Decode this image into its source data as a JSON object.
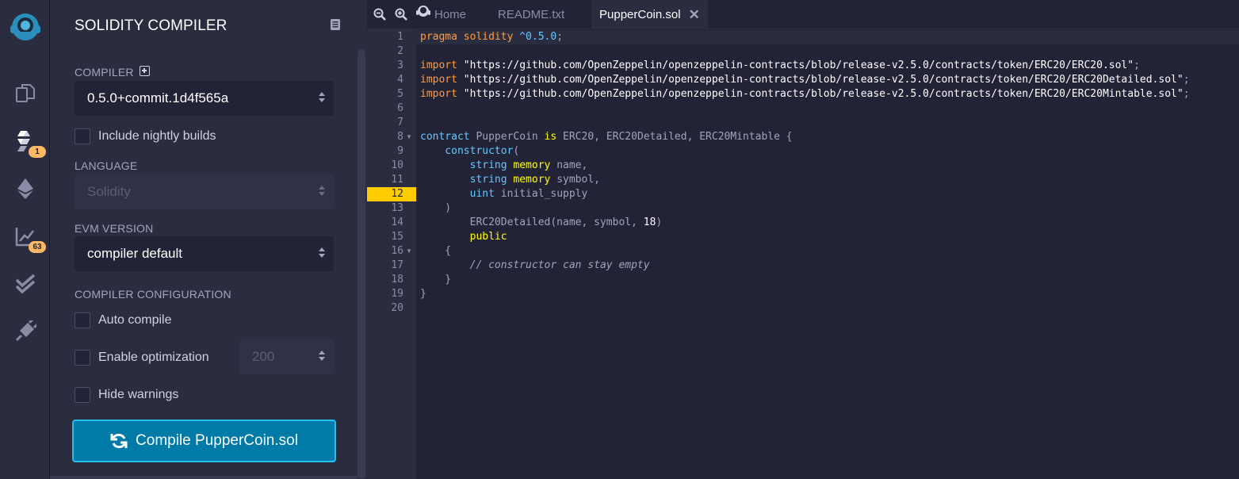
{
  "rail": {
    "badges": {
      "compiler": "1",
      "analysis": "63"
    }
  },
  "panel": {
    "title": "SOLIDITY COMPILER",
    "compiler_label": "COMPILER",
    "compiler_version": "0.5.0+commit.1d4f565a",
    "nightly_label": "Include nightly builds",
    "language_label": "LANGUAGE",
    "language_value": "Solidity",
    "evm_label": "EVM VERSION",
    "evm_value": "compiler default",
    "config_label": "COMPILER CONFIGURATION",
    "auto_compile_label": "Auto compile",
    "optimization_label": "Enable optimization",
    "optimization_runs": "200",
    "hide_warnings_label": "Hide warnings",
    "compile_button_label": "Compile PupperCoin.sol"
  },
  "tabs": [
    {
      "label": "Home"
    },
    {
      "label": "README.txt"
    },
    {
      "label": "PupperCoin.sol",
      "close": "✕"
    }
  ],
  "editor": {
    "highlighted_line": 12,
    "lines": [
      {
        "n": "1",
        "tokens": [
          [
            "pragma solidity ",
            "tk-pragma"
          ],
          [
            "^0.5.0",
            "tk-version"
          ],
          [
            ";",
            "tk-id"
          ]
        ]
      },
      {
        "n": "2",
        "tokens": []
      },
      {
        "n": "3",
        "tokens": [
          [
            "import ",
            "tk-import"
          ],
          [
            "\"https://github.com/OpenZeppelin/openzeppelin-contracts/blob/release-v2.5.0/contracts/token/ERC20/ERC20.sol\"",
            "tk-str"
          ],
          [
            ";",
            "tk-id"
          ]
        ]
      },
      {
        "n": "4",
        "tokens": [
          [
            "import ",
            "tk-import"
          ],
          [
            "\"https://github.com/OpenZeppelin/openzeppelin-contracts/blob/release-v2.5.0/contracts/token/ERC20/ERC20Detailed.sol\"",
            "tk-str"
          ],
          [
            ";",
            "tk-id"
          ]
        ]
      },
      {
        "n": "5",
        "tokens": [
          [
            "import ",
            "tk-import"
          ],
          [
            "\"https://github.com/OpenZeppelin/openzeppelin-contracts/blob/release-v2.5.0/contracts/token/ERC20/ERC20Mintable.sol\"",
            "tk-str"
          ],
          [
            ";",
            "tk-id"
          ]
        ]
      },
      {
        "n": "6",
        "tokens": []
      },
      {
        "n": "7",
        "tokens": []
      },
      {
        "n": "8",
        "fold": true,
        "tokens": [
          [
            "contract ",
            "tk-kw"
          ],
          [
            "PupperCoin ",
            "tk-id"
          ],
          [
            "is ",
            "tk-kw2"
          ],
          [
            "ERC20, ERC20Detailed, ERC20Mintable {",
            "tk-id"
          ]
        ]
      },
      {
        "n": "9",
        "tokens": [
          [
            "    constructor",
            "tk-kw"
          ],
          [
            "(",
            "tk-id"
          ]
        ]
      },
      {
        "n": "10",
        "tokens": [
          [
            "        string ",
            "tk-type"
          ],
          [
            "memory ",
            "tk-kw2"
          ],
          [
            "name,",
            "tk-id"
          ]
        ]
      },
      {
        "n": "11",
        "tokens": [
          [
            "        string ",
            "tk-type"
          ],
          [
            "memory ",
            "tk-kw2"
          ],
          [
            "symbol,",
            "tk-id"
          ]
        ]
      },
      {
        "n": "12",
        "tokens": [
          [
            "        uint ",
            "tk-type"
          ],
          [
            "initial_supply",
            "tk-id"
          ]
        ]
      },
      {
        "n": "13",
        "tokens": [
          [
            "    )",
            "tk-id"
          ]
        ]
      },
      {
        "n": "14",
        "tokens": [
          [
            "        ERC20Detailed(name, symbol, ",
            "tk-fn"
          ],
          [
            "18",
            "tk-num"
          ],
          [
            ")",
            "tk-id"
          ]
        ]
      },
      {
        "n": "15",
        "tokens": [
          [
            "        public",
            "tk-kw2"
          ]
        ]
      },
      {
        "n": "16",
        "fold": true,
        "tokens": [
          [
            "    {",
            "tk-id"
          ]
        ]
      },
      {
        "n": "17",
        "tokens": [
          [
            "        // constructor can stay empty",
            "tk-comment"
          ]
        ]
      },
      {
        "n": "18",
        "tokens": [
          [
            "    }",
            "tk-id"
          ]
        ]
      },
      {
        "n": "19",
        "tokens": [
          [
            "}",
            "tk-id"
          ]
        ]
      },
      {
        "n": "20",
        "tokens": []
      }
    ]
  }
}
